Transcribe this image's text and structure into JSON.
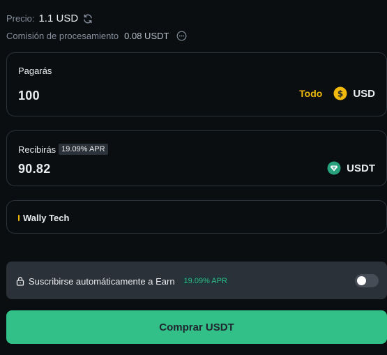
{
  "price": {
    "label": "Precio:",
    "value": "1.1 USD",
    "icon": "refresh-icon"
  },
  "fee": {
    "label": "Comisión de procesamiento",
    "value": "0.08 USDT",
    "icon": "more-options-icon"
  },
  "pay": {
    "label": "Pagarás",
    "amount": "100",
    "max_label": "Todo",
    "currency": "USD",
    "currency_icon": "dollar-coin-icon",
    "currency_icon_color": "#f0b90b"
  },
  "receive": {
    "label": "Recibirás",
    "apr": "19.09% APR",
    "amount": "90.82",
    "currency": "USDT",
    "currency_icon": "tether-icon",
    "currency_icon_color": "#26a17b"
  },
  "partner": {
    "name": "Wally Tech",
    "accent_color": "#f0b90b"
  },
  "earn": {
    "label": "Suscribirse automáticamente a Earn",
    "apr": "19.09% APR",
    "toggle_on": false
  },
  "buy_button": {
    "label": "Comprar USDT",
    "color": "#32c088"
  }
}
